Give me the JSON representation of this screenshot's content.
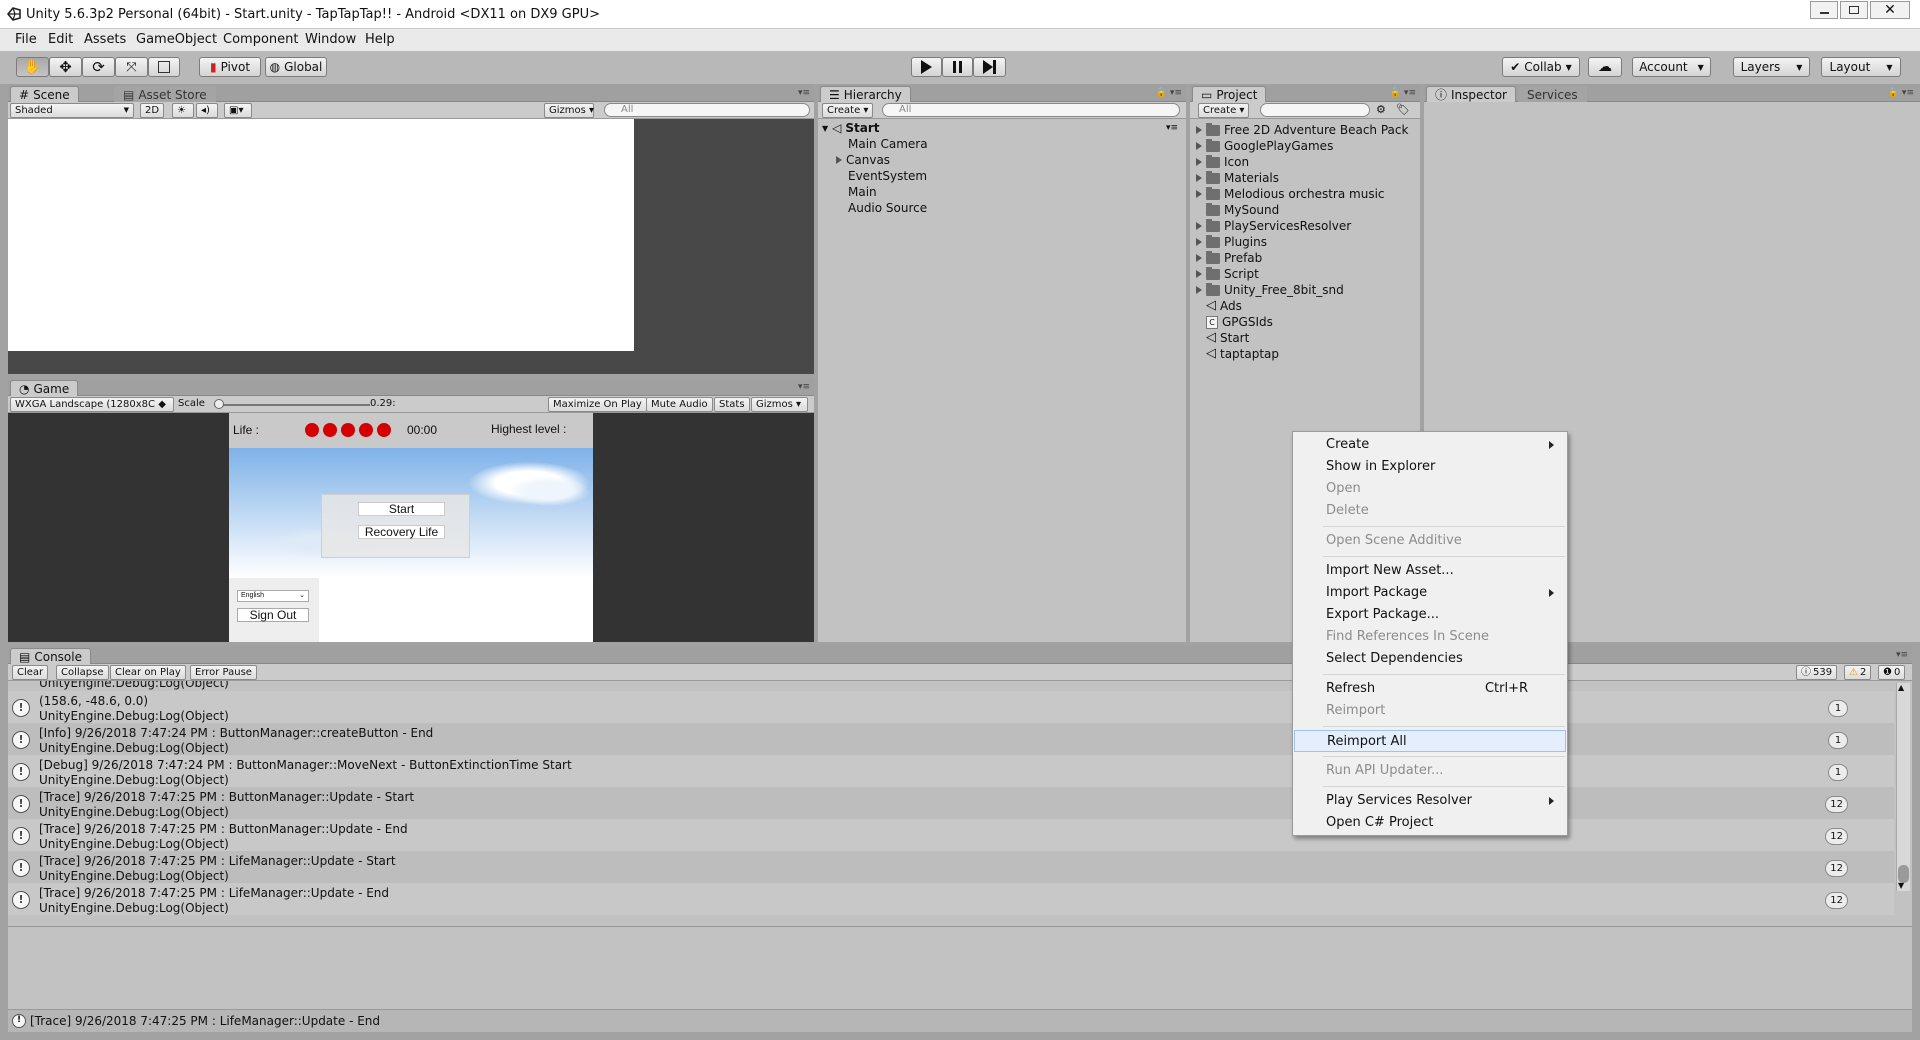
{
  "window": {
    "title": "Unity 5.6.3p2 Personal (64bit) - Start.unity - TapTapTap!! - Android <DX11 on DX9 GPU>"
  },
  "menu": [
    "File",
    "Edit",
    "Assets",
    "GameObject",
    "Component",
    "Window",
    "Help"
  ],
  "toolbar": {
    "pivot": "Pivot",
    "global": "Global",
    "collab": "Collab",
    "account": "Account",
    "layers": "Layers",
    "layout": "Layout"
  },
  "scene": {
    "tab": "Scene",
    "asset_store_tab": "Asset Store",
    "shading": "Shaded",
    "mode_2d": "2D",
    "gizmos": "Gizmos",
    "search_placeholder": "All"
  },
  "game": {
    "tab": "Game",
    "resolution": "WXGA Landscape (1280x8C",
    "scale_label": "Scale",
    "scale_value": "0.29",
    "scale_fraction": 0.03,
    "maximize": "Maximize On Play",
    "mute": "Mute Audio",
    "stats": "Stats",
    "gizmos": "Gizmos",
    "view": {
      "life_label": "Life :",
      "life_count": 5,
      "timer": "00:00",
      "highest_level": "Highest level :",
      "start_button": "Start",
      "recovery_button": "Recovery Life",
      "language": "English",
      "sign_out": "Sign Out"
    }
  },
  "hierarchy": {
    "tab": "Hierarchy",
    "create": "Create",
    "search_placeholder": "All",
    "scene": "Start",
    "items": [
      "Main Camera",
      "Canvas",
      "EventSystem",
      "Main",
      "Audio Source"
    ]
  },
  "project": {
    "tab": "Project",
    "create": "Create",
    "items": [
      {
        "label": "Free 2D Adventure Beach Pack",
        "type": "folder"
      },
      {
        "label": "GooglePlayGames",
        "type": "folder"
      },
      {
        "label": "Icon",
        "type": "folder"
      },
      {
        "label": "Materials",
        "type": "folder"
      },
      {
        "label": "Melodious orchestra music",
        "type": "folder"
      },
      {
        "label": "MySound",
        "type": "folder"
      },
      {
        "label": "PlayServicesResolver",
        "type": "folder"
      },
      {
        "label": "Plugins",
        "type": "folder"
      },
      {
        "label": "Prefab",
        "type": "folder"
      },
      {
        "label": "Script",
        "type": "folder"
      },
      {
        "label": "Unity_Free_8bit_snd",
        "type": "folder"
      },
      {
        "label": "Ads",
        "type": "unity-scene"
      },
      {
        "label": "GPGSIds",
        "type": "script"
      },
      {
        "label": "Start",
        "type": "unity-scene"
      },
      {
        "label": "taptaptap",
        "type": "unity-scene"
      }
    ]
  },
  "inspector": {
    "tab": "Inspector",
    "services_tab": "Services"
  },
  "console": {
    "tab": "Console",
    "buttons": [
      "Clear",
      "Collapse",
      "Clear on Play",
      "Error Pause"
    ],
    "counts": {
      "info": "539",
      "warn": "2",
      "error": "0"
    },
    "partial_line": "UnityEngine.Debug:Log(Object)",
    "rows": [
      {
        "line1": "(158.6, -48.6, 0.0)",
        "line2": "UnityEngine.Debug:Log(Object)",
        "count": "1"
      },
      {
        "line1": "[Info] 9/26/2018 7:47:24 PM : ButtonManager::createButton - End",
        "line2": "UnityEngine.Debug:Log(Object)",
        "count": "1"
      },
      {
        "line1": "[Debug] 9/26/2018 7:47:24 PM : ButtonManager::MoveNext - ButtonExtinctionTime Start",
        "line2": "UnityEngine.Debug:Log(Object)",
        "count": "1"
      },
      {
        "line1": "[Trace] 9/26/2018 7:47:25 PM : ButtonManager::Update - Start",
        "line2": "UnityEngine.Debug:Log(Object)",
        "count": "12"
      },
      {
        "line1": "[Trace] 9/26/2018 7:47:25 PM : ButtonManager::Update - End",
        "line2": "UnityEngine.Debug:Log(Object)",
        "count": "12"
      },
      {
        "line1": "[Trace] 9/26/2018 7:47:25 PM : LifeManager::Update - Start",
        "line2": "UnityEngine.Debug:Log(Object)",
        "count": "12"
      },
      {
        "line1": "[Trace] 9/26/2018 7:47:25 PM : LifeManager::Update - End",
        "line2": "UnityEngine.Debug:Log(Object)",
        "count": "12"
      }
    ]
  },
  "status_bar": "[Trace] 9/26/2018 7:47:25 PM : LifeManager::Update - End",
  "context_menu": {
    "items": [
      {
        "label": "Create",
        "submenu": true
      },
      {
        "label": "Show in Explorer"
      },
      {
        "label": "Open",
        "disabled": true
      },
      {
        "label": "Delete",
        "disabled": true
      },
      {
        "separator": true
      },
      {
        "label": "Open Scene Additive",
        "disabled": true
      },
      {
        "separator": true
      },
      {
        "label": "Import New Asset..."
      },
      {
        "label": "Import Package",
        "submenu": true
      },
      {
        "label": "Export Package..."
      },
      {
        "label": "Find References In Scene",
        "disabled": true
      },
      {
        "label": "Select Dependencies"
      },
      {
        "separator": true
      },
      {
        "label": "Refresh",
        "shortcut": "Ctrl+R"
      },
      {
        "label": "Reimport",
        "disabled": true
      },
      {
        "separator": true
      },
      {
        "label": "Reimport All",
        "highlighted": true
      },
      {
        "separator": true
      },
      {
        "label": "Run API Updater...",
        "disabled": true
      },
      {
        "separator": true
      },
      {
        "label": "Play Services Resolver",
        "submenu": true
      },
      {
        "label": "Open C# Project"
      }
    ]
  }
}
